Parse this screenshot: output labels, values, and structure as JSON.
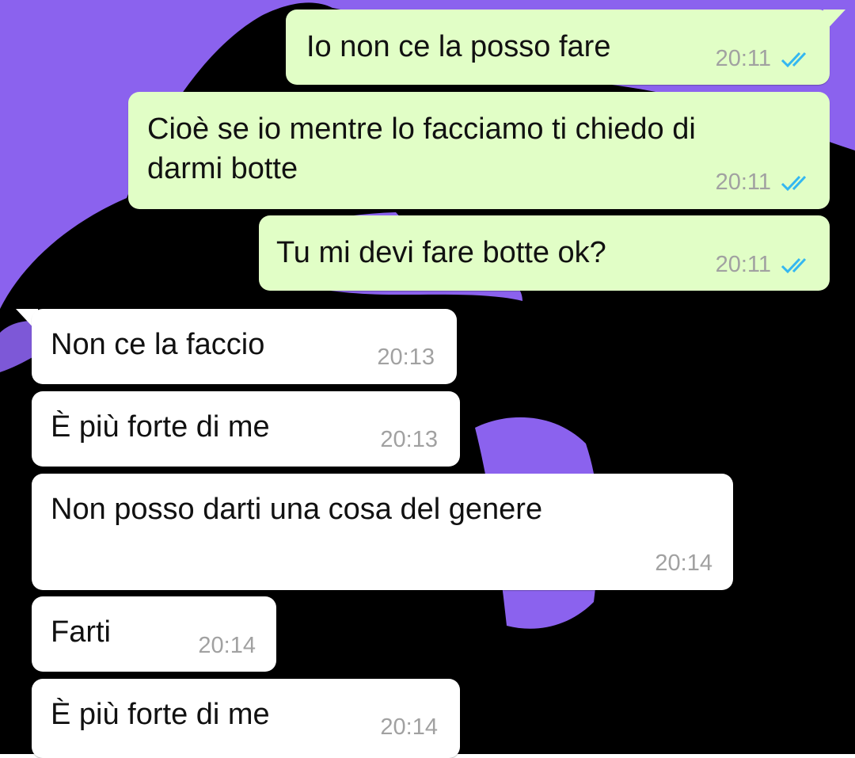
{
  "chat": {
    "accent_colors": {
      "outgoing_bubble": "#e1fec6",
      "incoming_bubble": "#ffffff",
      "read_ticks": "#34b7f1",
      "timestamp": "#a1a1a1",
      "wallpaper": "#8b62ee"
    },
    "messages": [
      {
        "direction": "outgoing",
        "text": "Io non ce la posso fare",
        "time": "20:11",
        "status": "read-double-tick-icon"
      },
      {
        "direction": "outgoing",
        "text_line1": "Cioè se io mentre lo facciamo ti chiedo di",
        "text_line2": "darmi botte",
        "time": "20:11",
        "status": "read-double-tick-icon"
      },
      {
        "direction": "outgoing",
        "text": "Tu mi devi fare botte ok?",
        "time": "20:11",
        "status": "read-double-tick-icon"
      },
      {
        "direction": "incoming",
        "text": "Non ce la faccio",
        "time": "20:13"
      },
      {
        "direction": "incoming",
        "text": "È più forte di me",
        "time": "20:13"
      },
      {
        "direction": "incoming",
        "text": "Non posso darti una cosa del genere",
        "time": "20:14"
      },
      {
        "direction": "incoming",
        "text": "Farti",
        "time": "20:14"
      },
      {
        "direction": "incoming",
        "text": "È più forte di me",
        "time": "20:14"
      }
    ]
  }
}
